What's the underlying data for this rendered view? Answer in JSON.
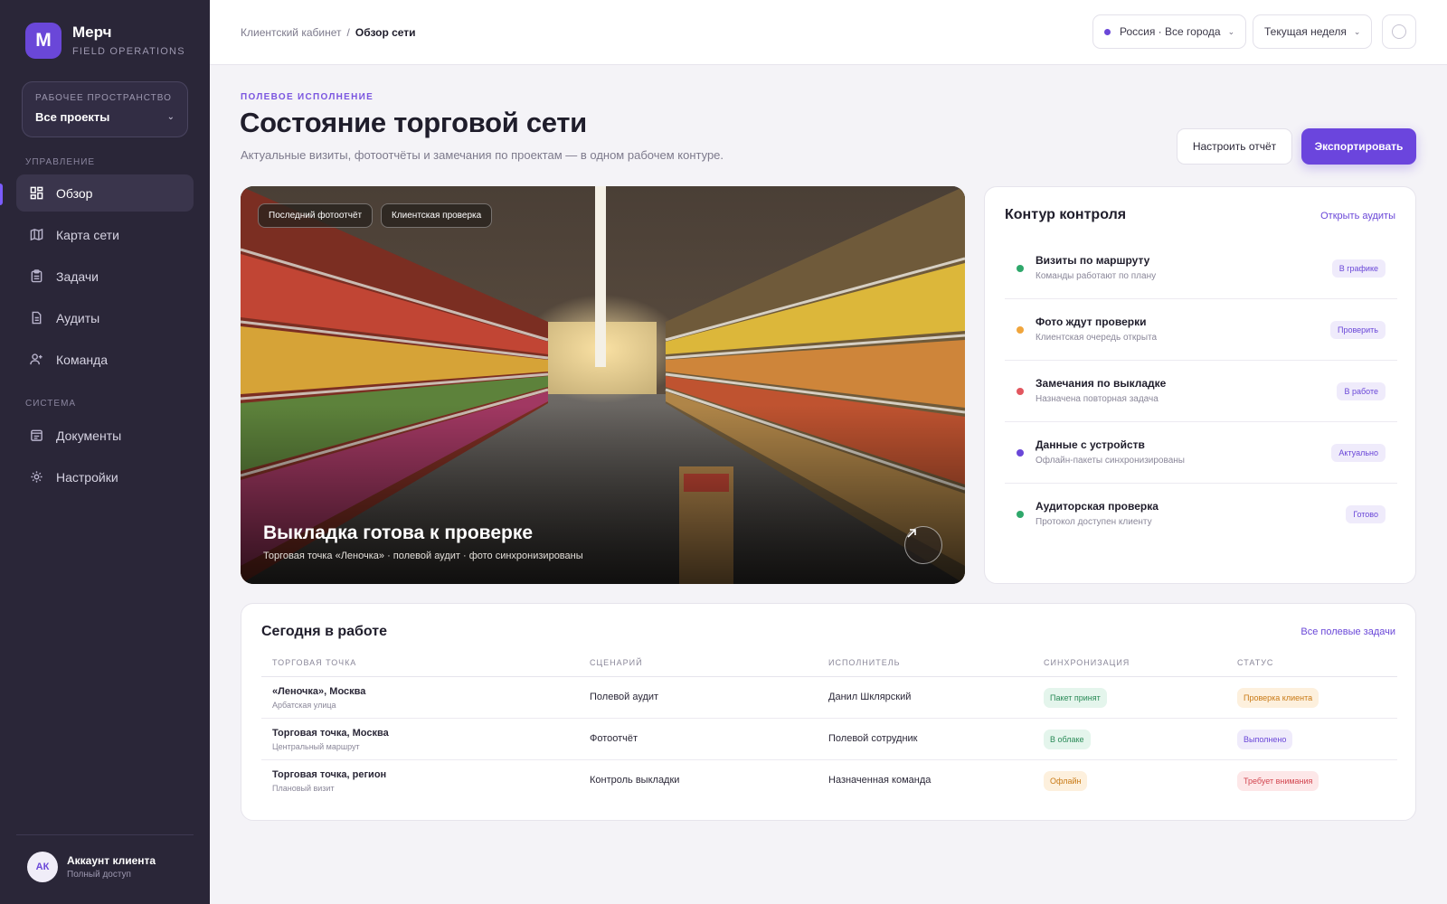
{
  "colors": {
    "accent": "#6a47d8",
    "sidebar_bg": "#2a2638",
    "green": "#2fa86b",
    "orange": "#f0a53c",
    "red": "#e2565f",
    "purple": "#6a47d8"
  },
  "brand": {
    "logo_letter": "М",
    "name": "Мерч",
    "subtitle": "FIELD OPERATIONS"
  },
  "workspace": {
    "label": "РАБОЧЕЕ ПРОСТРАНСТВО",
    "value": "Все проекты"
  },
  "sidebar": {
    "section_manage": "УПРАВЛЕНИЕ",
    "section_system": "СИСТЕМА",
    "items": [
      {
        "label": "Обзор",
        "icon": "dashboard-icon"
      },
      {
        "label": "Карта сети",
        "icon": "map-icon"
      },
      {
        "label": "Задачи",
        "icon": "clipboard-icon"
      },
      {
        "label": "Аудиты",
        "icon": "document-icon"
      },
      {
        "label": "Команда",
        "icon": "user-add-icon"
      },
      {
        "label": "Документы",
        "icon": "folder-icon"
      },
      {
        "label": "Настройки",
        "icon": "gear-icon"
      }
    ]
  },
  "account": {
    "initials": "АК",
    "name": "Аккаунт клиента",
    "role": "Полный доступ"
  },
  "breadcrumb": {
    "parent": "Клиентский кабинет",
    "separator": "/",
    "current": "Обзор сети"
  },
  "filters": {
    "region": "Россия · Все города",
    "period": "Текущая неделя"
  },
  "header": {
    "eyebrow": "ПОЛЕВОЕ ИСПОЛНЕНИЕ",
    "title": "Состояние торговой сети",
    "subtitle": "Актуальные визиты, фотоотчёты и замечания по проектам — в одном рабочем контуре.",
    "configure_button": "Настроить отчёт",
    "export_button": "Экспортировать"
  },
  "hero": {
    "chips": [
      "Последний фотоотчёт",
      "Клиентская проверка"
    ],
    "title": "Выкладка готова к проверке",
    "subtitle": "Торговая точка «Леночка» · полевой аудит · фото синхронизированы"
  },
  "control": {
    "title": "Контур контроля",
    "link": "Открыть аудиты",
    "rows": [
      {
        "title": "Визиты по маршруту",
        "sub": "Команды работают по плану",
        "badge": "В графике",
        "dot": "green"
      },
      {
        "title": "Фото ждут проверки",
        "sub": "Клиентская очередь открыта",
        "badge": "Проверить",
        "dot": "orange"
      },
      {
        "title": "Замечания по выкладке",
        "sub": "Назначена повторная задача",
        "badge": "В работе",
        "dot": "red"
      },
      {
        "title": "Данные с устройств",
        "sub": "Офлайн-пакеты синхронизированы",
        "badge": "Актуально",
        "dot": "purple"
      },
      {
        "title": "Аудиторская проверка",
        "sub": "Протокол доступен клиенту",
        "badge": "Готово",
        "dot": "green"
      }
    ]
  },
  "today": {
    "title": "Сегодня в работе",
    "link": "Все полевые задачи",
    "columns": [
      "ТОРГОВАЯ ТОЧКА",
      "СЦЕНАРИЙ",
      "ИСПОЛНИТЕЛЬ",
      "СИНХРОНИЗАЦИЯ",
      "СТАТУС"
    ],
    "rows": [
      {
        "point": "«Леночка», Москва",
        "point_sub": "Арбатская улица",
        "scenario": "Полевой аудит",
        "executor": "Данил Шклярский",
        "sync": "Пакет принят",
        "sync_tone": "green",
        "status": "Проверка клиента",
        "status_tone": "orange"
      },
      {
        "point": "Торговая точка, Москва",
        "point_sub": "Центральный маршрут",
        "scenario": "Фотоотчёт",
        "executor": "Полевой сотрудник",
        "sync": "В облаке",
        "sync_tone": "green",
        "status": "Выполнено",
        "status_tone": "purple"
      },
      {
        "point": "Торговая точка, регион",
        "point_sub": "Плановый визит",
        "scenario": "Контроль выкладки",
        "executor": "Назначенная команда",
        "sync": "Офлайн",
        "sync_tone": "orange",
        "status": "Требует внимания",
        "status_tone": "red"
      }
    ]
  }
}
